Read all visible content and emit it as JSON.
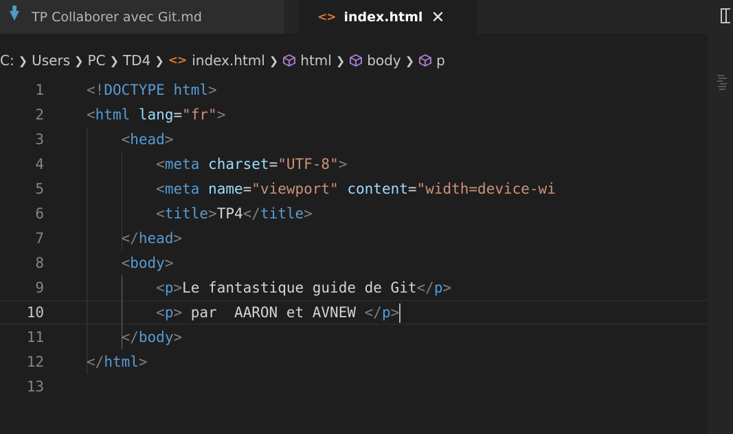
{
  "tabs": [
    {
      "label": "TP Collaborer avec Git.md",
      "icon": "markdown-file-icon",
      "active": false
    },
    {
      "label": "index.html",
      "icon": "html-file-icon",
      "active": true,
      "close": "✕"
    }
  ],
  "icons": {
    "html": "<>",
    "chevron": "›"
  },
  "breadcrumb": [
    "C:",
    "Users",
    "PC",
    "TD4",
    "index.html",
    "html",
    "body",
    "p"
  ],
  "editor": {
    "active_line": 10,
    "line_numbers": [
      "1",
      "2",
      "3",
      "4",
      "5",
      "6",
      "7",
      "8",
      "9",
      "10",
      "11",
      "12",
      "13"
    ],
    "lines": [
      "<!DOCTYPE html>",
      "<html lang=\"fr\">",
      "    <head>",
      "        <meta charset=\"UTF-8\">",
      "        <meta name=\"viewport\" content=\"width=device-wi",
      "        <title>TP4</title>",
      "    </head>",
      "    <body>",
      "        <p>Le fantastique guide de Git</p>",
      "        <p> par  AARON et AVNEW </p>",
      "    </body>",
      "</html>",
      ""
    ]
  },
  "colors": {
    "tag": "#569cd6",
    "attribute": "#9cdcfe",
    "string": "#ce9178",
    "punctuation": "#808080",
    "text": "#d4d4d4",
    "html_icon": "#e37933",
    "markdown_icon": "#519aba"
  }
}
